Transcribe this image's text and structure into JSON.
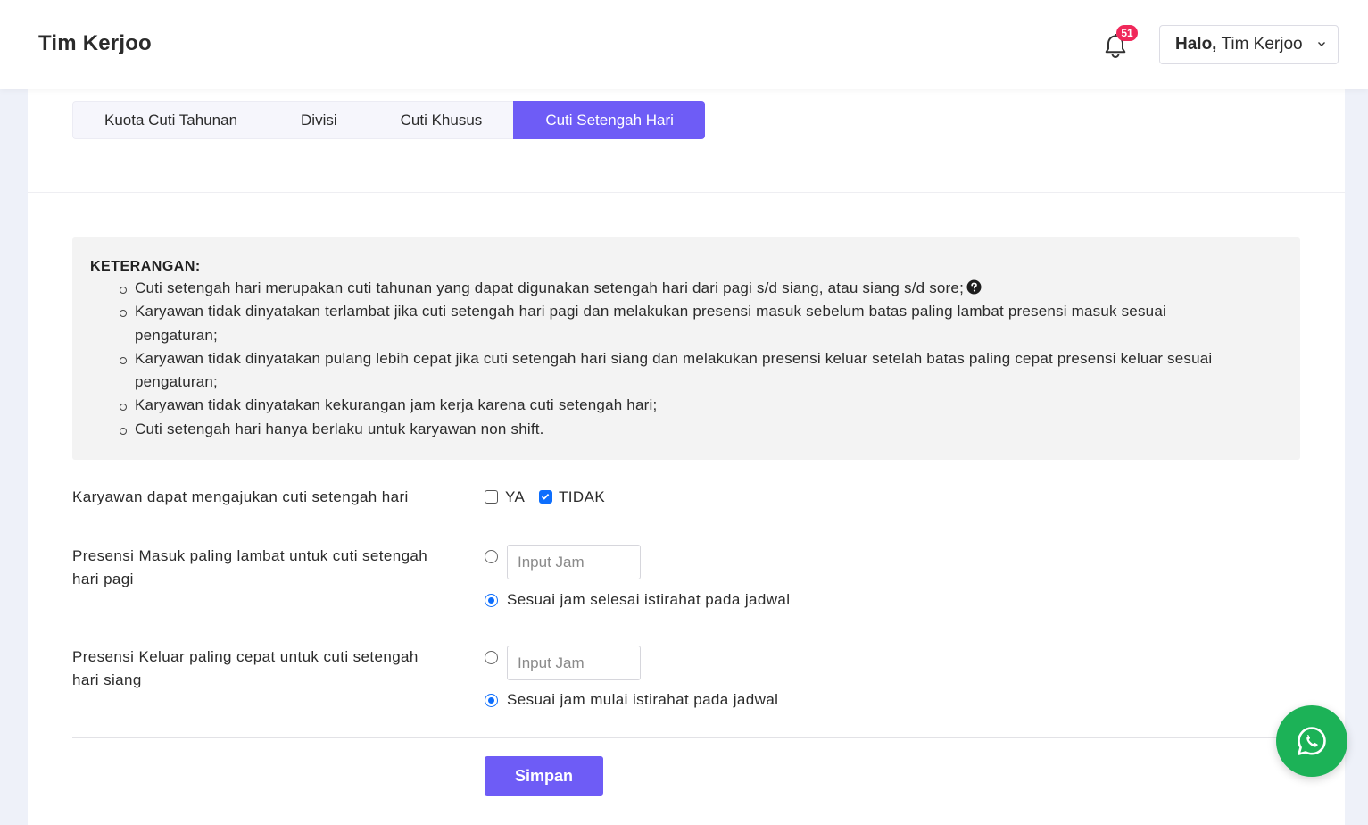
{
  "header": {
    "brand": "Tim Kerjoo",
    "notification_count": "51",
    "greeting_bold": "Halo,",
    "user_name": "Tim Kerjoo"
  },
  "tabs": [
    {
      "label": "Kuota Cuti Tahunan",
      "active": false
    },
    {
      "label": "Divisi",
      "active": false
    },
    {
      "label": "Cuti Khusus",
      "active": false
    },
    {
      "label": "Cuti Setengah Hari",
      "active": true
    }
  ],
  "info": {
    "title": "KETERANGAN:",
    "items": [
      "Cuti setengah hari merupakan cuti tahunan yang dapat digunakan setengah hari dari pagi s/d siang, atau siang s/d sore;",
      "Karyawan tidak dinyatakan terlambat jika cuti setengah hari pagi dan melakukan presensi masuk sebelum batas paling lambat presensi masuk sesuai pengaturan;",
      "Karyawan tidak dinyatakan pulang lebih cepat jika cuti setengah hari siang dan melakukan presensi keluar setelah batas paling cepat presensi keluar sesuai pengaturan;",
      "Karyawan tidak dinyatakan kekurangan jam kerja karena cuti setengah hari;",
      "Cuti setengah hari hanya berlaku untuk karyawan non shift."
    ]
  },
  "form": {
    "allow_label": "Karyawan dapat mengajukan cuti setengah hari",
    "option_yes": "YA",
    "option_no": "TIDAK",
    "yes_checked": false,
    "no_checked": true,
    "checkin_label": "Presensi Masuk paling lambat untuk cuti setengah hari pagi",
    "checkin_input_placeholder": "Input Jam",
    "checkin_input_value": "",
    "checkin_schedule_option": "Sesuai jam selesai istirahat pada jadwal",
    "checkin_selected": "schedule",
    "checkout_label": "Presensi Keluar paling cepat untuk cuti setengah hari siang",
    "checkout_input_placeholder": "Input Jam",
    "checkout_input_value": "",
    "checkout_schedule_option": "Sesuai jam mulai istirahat pada jadwal",
    "checkout_selected": "schedule",
    "save_label": "Simpan"
  },
  "colors": {
    "accent": "#6e5cf6",
    "badge": "#f0285a",
    "whatsapp": "#1cb257",
    "check_blue": "#0d6efd"
  },
  "icons": {
    "notification": "bell-icon",
    "user_menu": "chevron-down-icon",
    "help": "question-circle-icon",
    "chat": "whatsapp-icon"
  }
}
